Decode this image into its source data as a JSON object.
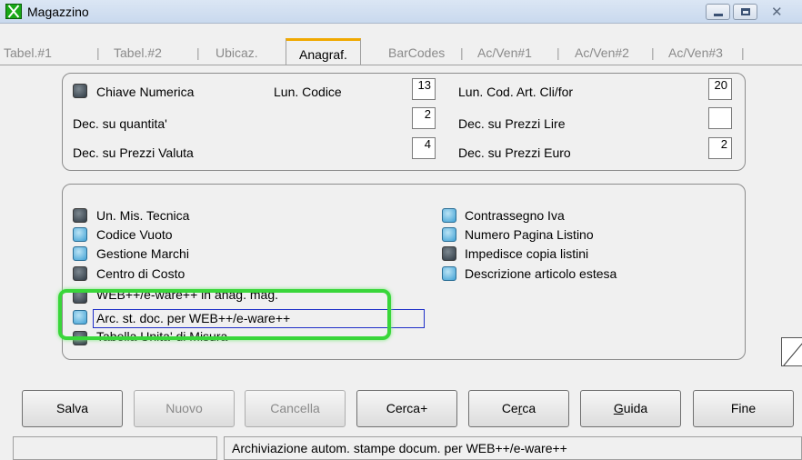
{
  "window": {
    "title": "Magazzino"
  },
  "tabs": [
    {
      "label": "Tabel.#1"
    },
    {
      "label": "Tabel.#2"
    },
    {
      "label": "Ubicaz."
    },
    {
      "label": "Anagraf."
    },
    {
      "label": "BarCodes"
    },
    {
      "label": "Ac/Ven#1"
    },
    {
      "label": "Ac/Ven#2"
    },
    {
      "label": "Ac/Ven#3"
    }
  ],
  "tab_separator": "|",
  "group1": {
    "chiave_numerica": {
      "label": "Chiave Numerica",
      "checked": true
    },
    "lun_codice": {
      "label": "Lun. Codice",
      "value": "13"
    },
    "lun_cod_art": {
      "label": "Lun. Cod. Art. Cli/for",
      "value": "20"
    },
    "dec_quantita": {
      "label": "Dec. su quantita'",
      "value": "2"
    },
    "dec_prezzi_lire": {
      "label": "Dec. su Prezzi Lire",
      "value": ""
    },
    "dec_prezzi_valuta": {
      "label": "Dec. su Prezzi Valuta",
      "value": "4"
    },
    "dec_prezzi_euro": {
      "label": "Dec. su Prezzi Euro",
      "value": "2"
    }
  },
  "group2": {
    "left": [
      {
        "label": "Un. Mis. Tecnica",
        "checked": true
      },
      {
        "label": "Codice Vuoto",
        "checked": false
      },
      {
        "label": "Gestione Marchi",
        "checked": false
      },
      {
        "label": "Centro di Costo",
        "checked": true
      },
      {
        "label": "WEB++/e-ware++ in anag. mag.",
        "checked": true
      },
      {
        "label": "Arc. st. doc. per WEB++/e-ware++",
        "checked": false
      },
      {
        "label": "Tabella Unita' di Misura",
        "checked": true
      }
    ],
    "right": [
      {
        "label": "Contrassegno Iva",
        "checked": false
      },
      {
        "label": "Numero Pagina Listino",
        "checked": false
      },
      {
        "label": "Impedisce copia listini",
        "checked": true
      },
      {
        "label": "Descrizione articolo estesa",
        "checked": false
      }
    ]
  },
  "buttons": {
    "salva": "Salva",
    "nuovo": "Nuovo",
    "cancella": "Cancella",
    "cerca_plus": "Cerca+",
    "cerca_pre": "Ce",
    "cerca_ul": "r",
    "cerca_post": "ca",
    "guida_ul": "G",
    "guida_post": "uida",
    "fine": "Fine"
  },
  "status": {
    "left": "",
    "message": "Archiviazione autom. stampe docum. per WEB++/e-ware++"
  },
  "colors": {
    "active_tab_accent": "#f0a800",
    "highlight": "#39d63a",
    "focus_border": "#1e2fc8"
  }
}
